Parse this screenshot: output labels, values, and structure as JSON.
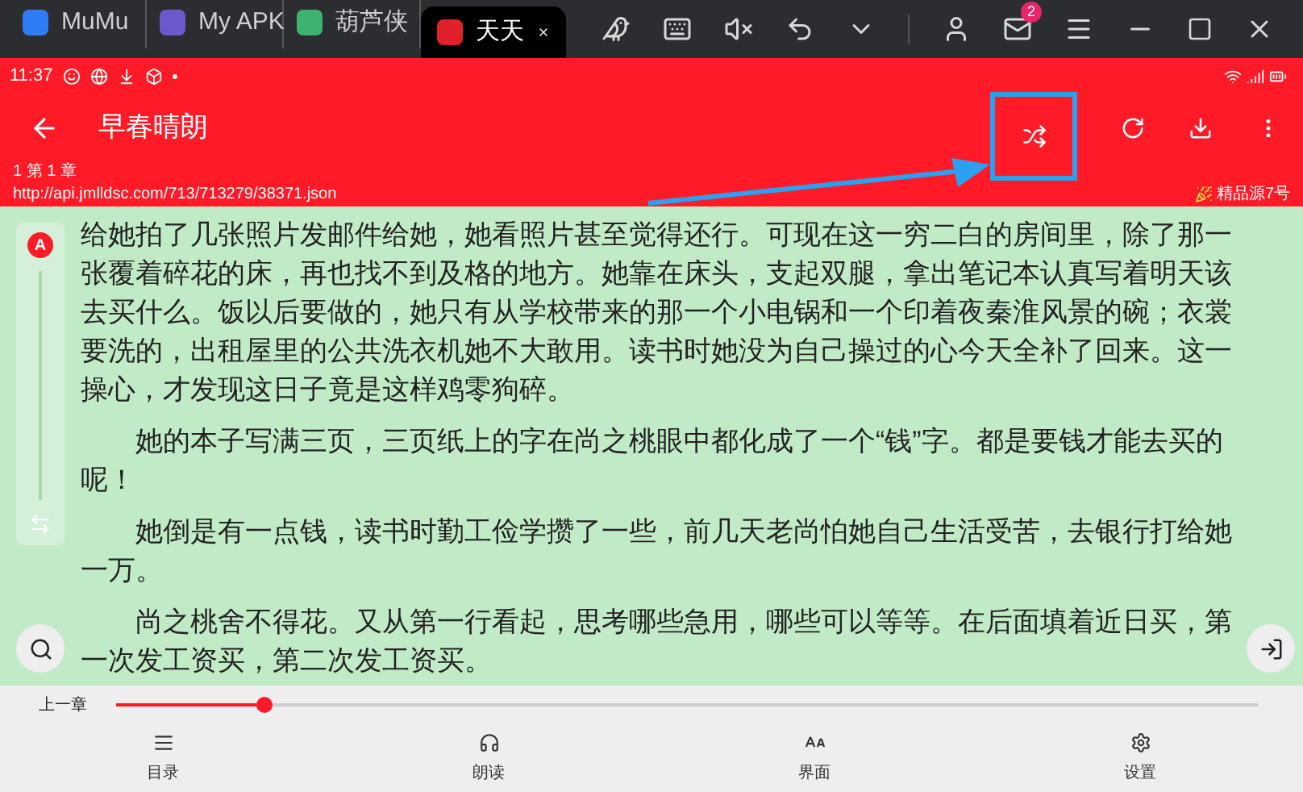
{
  "browser": {
    "tabs": [
      {
        "label": "MuMu",
        "selected": false,
        "color": "#2f7cf6"
      },
      {
        "label": "My APK",
        "selected": false,
        "color": "#6a5acd"
      },
      {
        "label": "葫芦侠",
        "selected": false,
        "color": "#3cb371"
      },
      {
        "label": "天天",
        "selected": true,
        "color": "#e0202a"
      }
    ],
    "mail_badge": "2"
  },
  "status_bar": {
    "time": "11:37"
  },
  "app_bar": {
    "title": "早春晴朗",
    "chapter": "1 第 1 章",
    "url": "http://api.jmlldsc.com/713/713279/38371.json",
    "source": "精品源7号"
  },
  "side_panel": {
    "badge": "A"
  },
  "paragraphs": [
    "给她拍了几张照片发邮件给她，她看照片甚至觉得还行。可现在这一穷二白的房间里，除了那一张覆着碎花的床，再也找不到及格的地方。她靠在床头，支起双腿，拿出笔记本认真写着明天该去买什么。饭以后要做的，她只有从学校带来的那一个小电锅和一个印着夜秦淮风景的碗；衣裳要洗的，出租屋里的公共洗衣机她不大敢用。读书时她没为自己操过的心今天全补了回来。这一操心，才发现这日子竟是这样鸡零狗碎。",
    "她的本子写满三页，三页纸上的字在尚之桃眼中都化成了一个“钱”字。都是要钱才能去买的呢！",
    "她倒是有一点钱，读书时勤工俭学攒了一些，前几天老尚怕她自己生活受苦，去银行打给她一万。",
    "尚之桃舍不得花。又从第一行看起，思考哪些急用，哪些可以等等。在后面填着近日买，第一次发工资买，第二次发工资买。"
  ],
  "progress": {
    "prev_label": "上一章",
    "level": 0.13
  },
  "nav": [
    {
      "label": "目录",
      "kind": "list"
    },
    {
      "label": "朗读",
      "kind": "listen"
    },
    {
      "label": "界面",
      "kind": "font"
    },
    {
      "label": "设置",
      "kind": "settings"
    }
  ]
}
